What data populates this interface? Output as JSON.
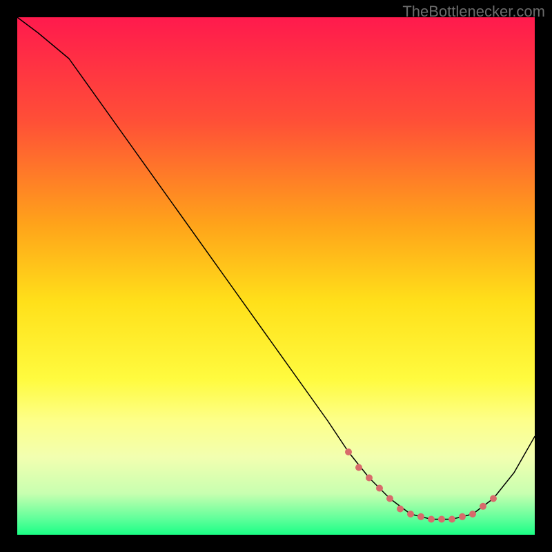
{
  "watermark": "TheBottlenecker.com",
  "chart_data": {
    "type": "line",
    "title": "",
    "xlabel": "",
    "ylabel": "",
    "xlim": [
      0,
      100
    ],
    "ylim": [
      0,
      100
    ],
    "grid": false,
    "background_gradient": {
      "stops": [
        {
          "offset": 0,
          "color": "#ff1a4d"
        },
        {
          "offset": 20,
          "color": "#ff4f37"
        },
        {
          "offset": 40,
          "color": "#ffa31a"
        },
        {
          "offset": 55,
          "color": "#ffe01a"
        },
        {
          "offset": 70,
          "color": "#fffb3f"
        },
        {
          "offset": 78,
          "color": "#fdff8a"
        },
        {
          "offset": 85,
          "color": "#f2ffb0"
        },
        {
          "offset": 92,
          "color": "#c8ffb0"
        },
        {
          "offset": 97,
          "color": "#5eff9a"
        },
        {
          "offset": 100,
          "color": "#1aff85"
        }
      ]
    },
    "series": [
      {
        "name": "bottleneck-curve",
        "color": "#000000",
        "stroke_width": 1.5,
        "x": [
          0,
          4,
          10,
          20,
          30,
          40,
          50,
          60,
          64,
          68,
          72,
          76,
          80,
          84,
          88,
          92,
          96,
          100
        ],
        "y": [
          100,
          97,
          92,
          78,
          64,
          50,
          36,
          22,
          16,
          11,
          7,
          4,
          3,
          3,
          4,
          7,
          12,
          19
        ]
      }
    ],
    "markers": {
      "name": "sampled-dots",
      "color": "#d86b6b",
      "radius": 5,
      "x": [
        64,
        66,
        68,
        70,
        72,
        74,
        76,
        78,
        80,
        82,
        84,
        86,
        88,
        90,
        92
      ],
      "y": [
        16,
        13,
        11,
        9,
        7,
        5,
        4,
        3.5,
        3,
        3,
        3,
        3.5,
        4,
        5.5,
        7
      ]
    }
  }
}
